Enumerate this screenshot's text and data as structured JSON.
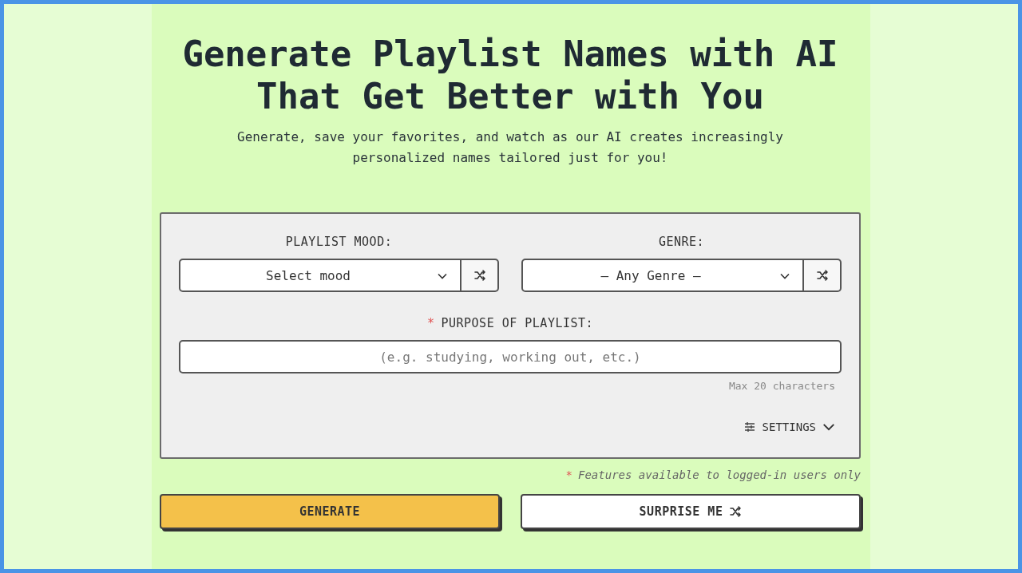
{
  "heading": {
    "title": "Generate Playlist Names with AI That Get Better with You",
    "subtitle": "Generate, save your favorites, and watch as our AI creates increasingly personalized names tailored just for you!"
  },
  "form": {
    "selects": [
      {
        "label": "PLAYLIST MOOD:",
        "value": "Select mood"
      },
      {
        "label": "GENRE:",
        "value": "– Any Genre –"
      }
    ],
    "purpose": {
      "marker": "*",
      "label": "PURPOSE OF PLAYLIST:",
      "placeholder": "(e.g. studying, working out, etc.)",
      "hint": "Max 20 characters"
    },
    "settings": {
      "label": "SETTINGS",
      "expanded": false
    }
  },
  "note": {
    "marker": "*",
    "text": "Features available to logged-in users only"
  },
  "buttons": [
    {
      "kind": "primary",
      "label": "GENERATE"
    },
    {
      "kind": "shuffle",
      "label": "SURPRISE ME"
    }
  ]
}
